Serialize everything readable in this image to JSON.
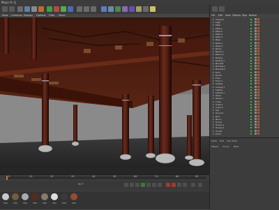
{
  "app": {
    "title": "Maya 中 主"
  },
  "viewport": {
    "menu": [
      "View",
      "Cameras",
      "Display",
      "Options",
      "Filter",
      "Panel"
    ]
  },
  "timeline": {
    "frame_labels": [
      "0",
      "10",
      "20",
      "30",
      "40",
      "50",
      "60",
      "70",
      "80",
      "90"
    ],
    "end_frame": "90 F"
  },
  "materials": {
    "items": [
      {
        "label": "Mat",
        "color": "#c9c9c9"
      },
      {
        "label": "Mat",
        "color": "#7a5a3a"
      },
      {
        "label": "Mat",
        "color": "#aaaaaa"
      },
      {
        "label": "Mat",
        "color": "#5a2a1a"
      },
      {
        "label": "Mat",
        "color": "#8a7a6a"
      },
      {
        "label": "Mat",
        "color": "#dedede"
      },
      {
        "label": "Mat",
        "color": "#3a3a3a"
      },
      {
        "label": "Mat",
        "color": "#9a4a2a"
      }
    ]
  },
  "right_panel": {
    "menu": [
      "File",
      "Edit",
      "View",
      "Objects",
      "Tags",
      "Bookm"
    ],
    "objects": [
      "Camera",
      "Light",
      "Pillar",
      "Pillar.1",
      "Pillar.2",
      "Pillar.3",
      "Pillar.4",
      "Base",
      "Base.1",
      "Base.2",
      "Beam",
      "Beam.1",
      "Beam.2",
      "Railing",
      "Railing.1",
      "Bracket",
      "Bracket.1",
      "Bracket.2",
      "Roof",
      "Roof.1",
      "Floor",
      "Floor.1",
      "Ceiling",
      "Ceiling.1",
      "Lattice",
      "Lattice.1",
      "Panel",
      "Panel.1",
      "Cube",
      "Cube.1",
      "Cube.2",
      "Sky",
      "Ground",
      "Null",
      "Null.1",
      "Group",
      "Group.1",
      "Group.2",
      "Cloner",
      "Extra"
    ],
    "attributes": [
      "Mode",
      "Edit",
      "User Data",
      "Object",
      "Coord.",
      "Basic"
    ]
  }
}
